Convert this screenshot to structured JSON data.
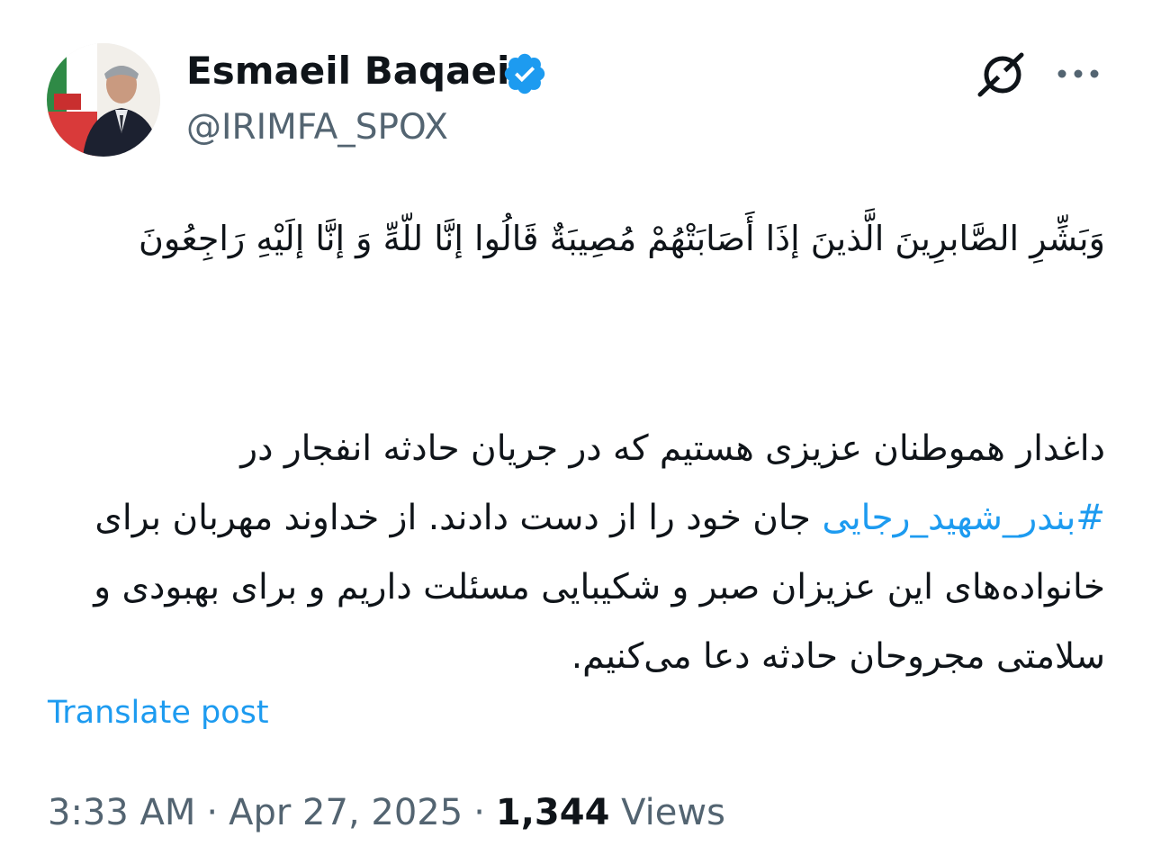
{
  "author": {
    "display_name": "Esmaeil Baqaei",
    "handle": "@IRIMFA_SPOX",
    "verified": true,
    "verified_color": "#1d9bf0"
  },
  "header_icons": {
    "grok": "grok-icon",
    "more": "more-icon"
  },
  "post": {
    "verse": "وَبَشِّرِ الصَّابرِينَ الَّذينَ إذَا أَصَابَتْهُمْ مُصِيبَةٌ قَالُوا إنَّا للّهِّ وَ إنَّا إلَيْهِ رَاجِعُونَ",
    "message_part1": "داغدار هموطنان عزیزی هستیم که در جریان حادثه انفجار در ",
    "hashtag": "#بندر_شهید_رجایی",
    "message_part2": " جان خود را از دست دادند. از خداوند مهربان برای خانواده‌های این عزیزان صبر و شکیبایی مسئلت داریم و برای بهبودی و سلامتی مجروحان حادثه دعا می‌کنیم."
  },
  "translate_label": "Translate post",
  "meta": {
    "time": "3:33 AM",
    "separator": "·",
    "date": "Apr 27, 2025",
    "views_count": "1,344",
    "views_label": "Views"
  },
  "colors": {
    "link": "#1d9bf0",
    "text": "#0f1419",
    "muted": "#536471"
  }
}
